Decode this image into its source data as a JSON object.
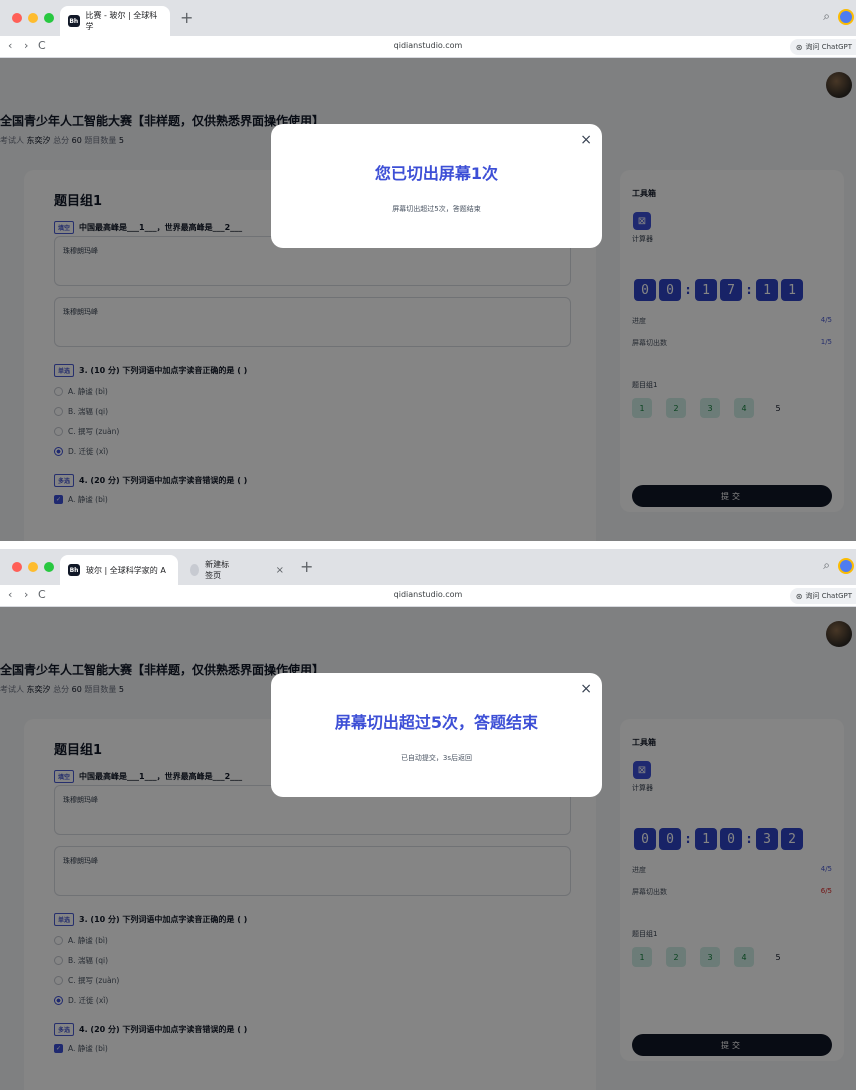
{
  "shared": {
    "url": "qidianstudio.com",
    "nav": {
      "back": "‹",
      "forward": "›",
      "reload": "C"
    },
    "chatgpt_label": "询问 ChatGPT",
    "new_tab": "+",
    "exam_title": "全国青少年人工智能大赛【非样题，仅供熟悉界面操作使用】",
    "meta": {
      "candidate_label": "考试人",
      "candidate": "东奕汐",
      "score_label": "总分",
      "score": "60",
      "count_label": "题目数量",
      "count": "5"
    },
    "group_title": "题目组1",
    "q1": {
      "tag": "填空",
      "text": "中国最高峰是___1___，世界最高峰是___2___"
    },
    "answers": [
      "珠穆朗玛峰",
      "珠穆朗玛峰"
    ],
    "q3": {
      "tag": "单选",
      "text": "3. (10 分) 下列词语中加点字读音正确的是 ( )"
    },
    "q3_options": [
      "A. 静谧 (bì)",
      "B. 湍辐 (qi)",
      "C. 撰写 (zuàn)",
      "D. 迁徙 (xǐ)"
    ],
    "q4": {
      "tag": "多选",
      "text": "4. (20 分) 下列词语中加点字读音错误的是 ( )"
    },
    "q4_option_a": "A. 静谧 (bì)",
    "tools": {
      "title": "工具箱",
      "calculator": "计算器",
      "progress_label": "进度",
      "progress_value": "4/5",
      "switch_label": "屏幕切出数",
      "group_label": "题目组1",
      "question_numbers": [
        "1",
        "2",
        "3",
        "4",
        "5"
      ],
      "submit": "提交"
    },
    "colors": {
      "accent": "#3d4fd6",
      "danger": "#dc2626",
      "answered": "#cfeee6"
    }
  },
  "screens": [
    {
      "tabs": [
        {
          "label": "比赛 - 玻尔 | 全球科学"
        }
      ],
      "timer": [
        "0",
        "0",
        "1",
        "7",
        "1",
        "1"
      ],
      "switch_count": "1/5",
      "modal": {
        "title": "您已切出屏幕1次",
        "message": "屏幕切出超过5次，答题结束"
      }
    },
    {
      "tabs": [
        {
          "label": "玻尔 | 全球科学家的 A"
        },
        {
          "label": "新建标签页",
          "close": "×"
        }
      ],
      "timer": [
        "0",
        "0",
        "1",
        "0",
        "3",
        "2"
      ],
      "switch_count": "6/5",
      "modal": {
        "title": "屏幕切出超过5次，答题结束",
        "message": "已自动提交，3s后返回"
      }
    }
  ]
}
